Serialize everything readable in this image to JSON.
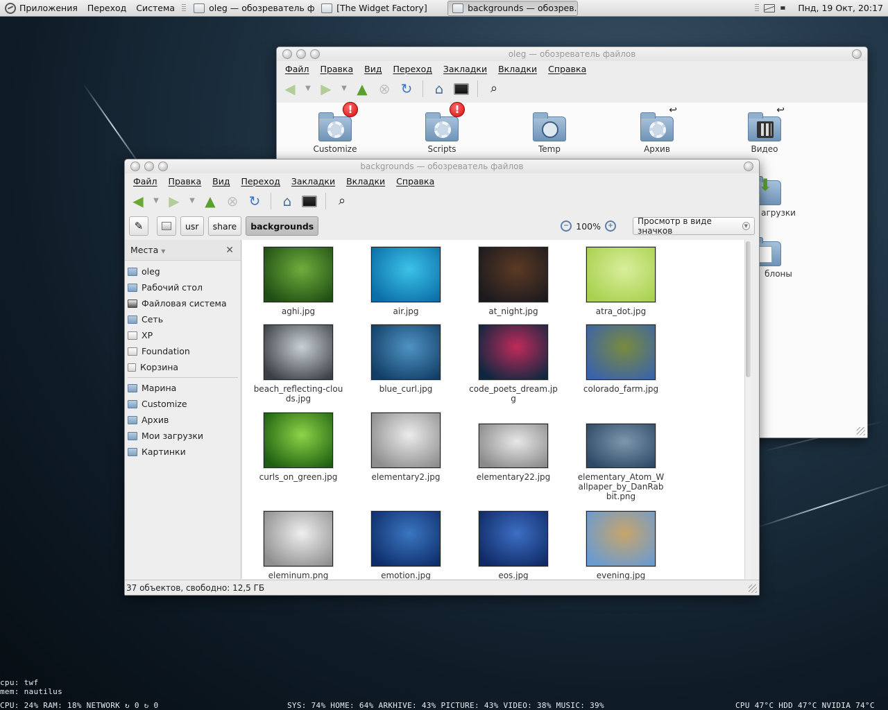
{
  "panel": {
    "menus": [
      "Приложения",
      "Переход",
      "Система"
    ],
    "tasks": [
      {
        "label": "oleg — обозреватель ф...",
        "active": false
      },
      {
        "label": "[The Widget Factory]",
        "active": false
      },
      {
        "label": "backgrounds — обозрев...",
        "active": true
      }
    ],
    "clock": "Пнд, 19 Окт, 20:17"
  },
  "back_window": {
    "title": "oleg — обозреватель файлов",
    "menu": [
      "Файл",
      "Правка",
      "Вид",
      "Переход",
      "Закладки",
      "Вкладки",
      "Справка"
    ],
    "icons": [
      {
        "label": "Customize",
        "badge": "!"
      },
      {
        "label": "Scripts",
        "badge": "!"
      },
      {
        "label": "Temp"
      },
      {
        "label": "Архив"
      },
      {
        "label": "Видео"
      }
    ],
    "partial_labels": [
      "агрузки",
      "блоны"
    ]
  },
  "main_window": {
    "title": "backgrounds — обозреватель файлов",
    "menu": [
      "Файл",
      "Правка",
      "Вид",
      "Переход",
      "Закладки",
      "Вкладки",
      "Справка"
    ],
    "path": [
      "usr",
      "share",
      "backgrounds"
    ],
    "zoom": "100%",
    "view_mode": "Просмотр в виде значков",
    "sidebar": {
      "header": "Места",
      "places": [
        {
          "label": "oleg",
          "icon": "home-icon"
        },
        {
          "label": "Рабочий стол",
          "icon": "folder-icon"
        },
        {
          "label": "Файловая система",
          "icon": "drive-icon"
        },
        {
          "label": "Сеть",
          "icon": "network-icon"
        },
        {
          "label": "XP",
          "icon": "drive-icon"
        },
        {
          "label": "Foundation",
          "icon": "drive-icon"
        },
        {
          "label": "Корзина",
          "icon": "trash-icon"
        }
      ],
      "bookmarks": [
        {
          "label": "Марина"
        },
        {
          "label": "Customize"
        },
        {
          "label": "Архив"
        },
        {
          "label": "Мои загрузки"
        },
        {
          "label": "Картинки"
        }
      ]
    },
    "files": [
      {
        "name": "aghi.jpg",
        "c1": "#1f4d14",
        "c2": "#6fae3c"
      },
      {
        "name": "air.jpg",
        "c1": "#0b6ea8",
        "c2": "#3cc3e8"
      },
      {
        "name": "at_night.jpg",
        "c1": "#1c1a1e",
        "c2": "#5c3a24"
      },
      {
        "name": "atra_dot.jpg",
        "c1": "#a8d14f",
        "c2": "#d9ee9c"
      },
      {
        "name": "beach_reflecting-clouds.jpg",
        "c1": "#3b4046",
        "c2": "#c9d0d6"
      },
      {
        "name": "blue_curl.jpg",
        "c1": "#123e66",
        "c2": "#4f93c4"
      },
      {
        "name": "code_poets_dream.jpg",
        "c1": "#0d2740",
        "c2": "#c02a5a"
      },
      {
        "name": "colorado_farm.jpg",
        "c1": "#3b64a8",
        "c2": "#7a8a3e"
      },
      {
        "name": "curls_on_green.jpg",
        "c1": "#1d5f10",
        "c2": "#8ed448"
      },
      {
        "name": "elementary2.jpg",
        "c1": "#8d8d8d",
        "c2": "#ececec"
      },
      {
        "name": "elementary22.jpg",
        "c1": "#8a8a8a",
        "c2": "#e8e8e8"
      },
      {
        "name": "elementary_Atom_Wallpaper_by_DanRabbit.png",
        "c1": "#2e4a66",
        "c2": "#7d97ae"
      },
      {
        "name": "eleminum.png",
        "c1": "#8f8f8f",
        "c2": "#efefef"
      },
      {
        "name": "emotion.jpg",
        "c1": "#0e2e6b",
        "c2": "#3b76c1"
      },
      {
        "name": "eos.jpg",
        "c1": "#0f2a66",
        "c2": "#3d6fc4"
      },
      {
        "name": "evening.jpg",
        "c1": "#6a9bd1",
        "c2": "#c8a56a"
      }
    ],
    "status": "37 объектов, свободно: 12,5 ГБ"
  },
  "conky": {
    "cpu_proc": "cpu: twf",
    "mem_proc": "mem: nautilus",
    "left": "CPU: 24% RAM: 18% NETWORK ↻ 0 ↻ 0",
    "center": "SYS: 74% HOME: 64% ARKHIVE: 43% PICTURE: 43% VIDEO: 38% MUSIC: 39%",
    "right": "CPU 47°C   HDD 47°C   NVIDIA 74°C"
  }
}
